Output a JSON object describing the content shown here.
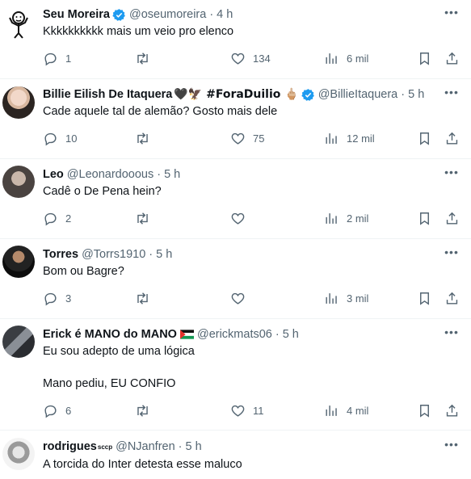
{
  "tweets": [
    {
      "name": "Seu Moreira",
      "handle": "@oseumoreira",
      "time": "4 h",
      "text": "Kkkkkkkkkk mais um veio pro elenco",
      "replies": "1",
      "retweets": "",
      "likes": "134",
      "views": "6 mil",
      "verified": true,
      "avatar": "shrug-doodle-avatar"
    },
    {
      "name": "Billie Eilish De Itaquera",
      "name_emojis": "🖤🦅 #ForaDuilio 🖕🏼",
      "handle": "@BillieItaquera",
      "time": "5 h",
      "text": "Cade aquele tal de alemão? Gosto mais dele",
      "replies": "10",
      "retweets": "",
      "likes": "75",
      "views": "12 mil",
      "verified": true,
      "avatar": "photo-avatar"
    },
    {
      "name": "Leo",
      "handle": "@Leonardooous",
      "time": "5 h",
      "text": "Cadê o De Pena hein?",
      "replies": "2",
      "retweets": "",
      "likes": "",
      "views": "2 mil",
      "avatar": "photo-avatar"
    },
    {
      "name": "Torres",
      "handle": "@Torrs1910",
      "time": "5 h",
      "text": "Bom ou Bagre?",
      "replies": "3",
      "retweets": "",
      "likes": "",
      "views": "3 mil",
      "avatar": "photo-avatar"
    },
    {
      "name": "Erick é MANO do MANO",
      "name_emojis": "🇵🇸",
      "handle": "@erickmats06",
      "time": "5 h",
      "text": "Eu sou adepto de uma lógica\n\nMano pediu, EU CONFIO",
      "replies": "6",
      "retweets": "",
      "likes": "11",
      "views": "4 mil",
      "avatar": "photo-avatar"
    },
    {
      "name": "rodrigues",
      "name_suffix": "sccp",
      "handle": "@NJanfren",
      "time": "5 h",
      "text": "A torcida do Inter detesta esse maluco",
      "avatar": "photo-avatar"
    }
  ],
  "colors": {
    "text": "#0f1419",
    "secondary": "#536471",
    "verified": "#1d9bf0",
    "divider": "#eff3f4"
  },
  "icons": [
    "reply-icon",
    "retweet-icon",
    "like-icon",
    "views-icon",
    "bookmark-icon",
    "share-icon",
    "more-icon",
    "verified-icon"
  ]
}
